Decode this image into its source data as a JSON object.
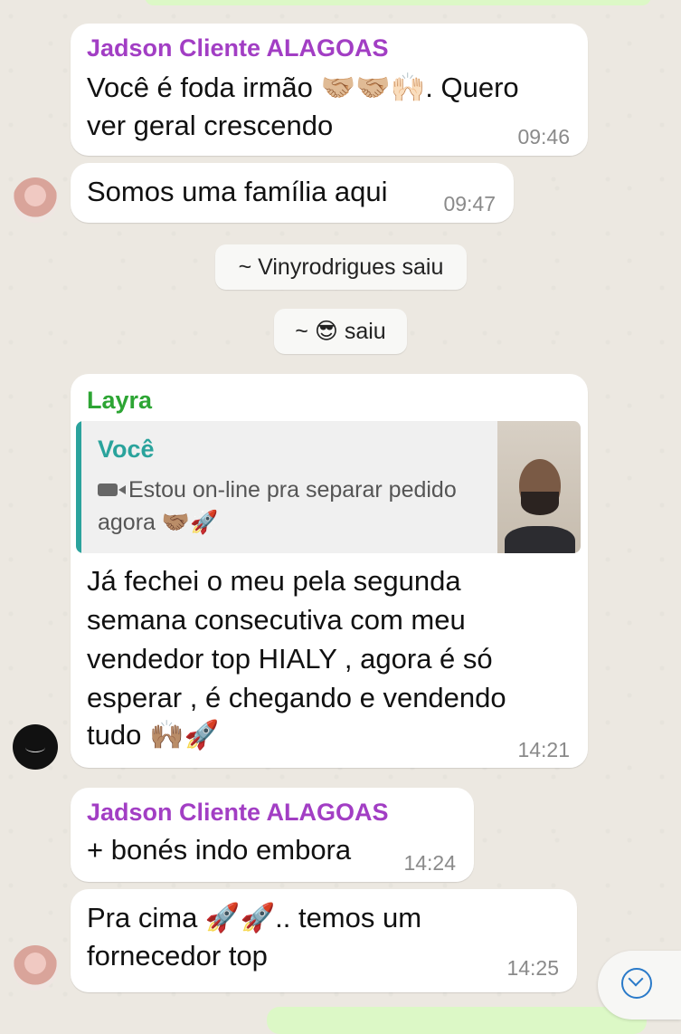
{
  "messages": [
    {
      "sender": "Jadson Cliente ALAGOAS",
      "lines": [
        "Você é foda irmão 🤝🏼🤝🏼🙌🏻. Quero",
        "ver geral crescendo"
      ],
      "time": "09:46"
    },
    {
      "lines": [
        "Somos uma família aqui"
      ],
      "time": "09:47"
    },
    {
      "sender": "Layra",
      "reply": {
        "author": "Você",
        "lines": [
          "Estou on-line pra separar pedido",
          "agora 🤝🏽🚀"
        ]
      },
      "lines": [
        "Já fechei o meu pela segunda",
        "semana consecutiva com meu",
        "vendedor top HIALY , agora é só",
        "esperar , é chegando e vendendo",
        "tudo 🙌🏽🚀"
      ],
      "time": "14:21"
    },
    {
      "sender": "Jadson Cliente ALAGOAS",
      "lines": [
        "+ bonés indo embora"
      ],
      "time": "14:24"
    },
    {
      "lines": [
        "Pra cima 🚀🚀.. temos um",
        "fornecedor top"
      ],
      "time": "14:25"
    }
  ],
  "system_notices": [
    "~ Vinyrodrigues saiu",
    "~ 😎 saiu"
  ],
  "colors": {
    "sender_purple": "#a23ec4",
    "sender_green": "#2da534",
    "quote_accent": "#2aa39c",
    "scroll_accent": "#2a7ac9"
  },
  "icons": [
    "video-camera-icon",
    "chevron-down-icon",
    "avatar-pink",
    "avatar-layra-logo"
  ]
}
